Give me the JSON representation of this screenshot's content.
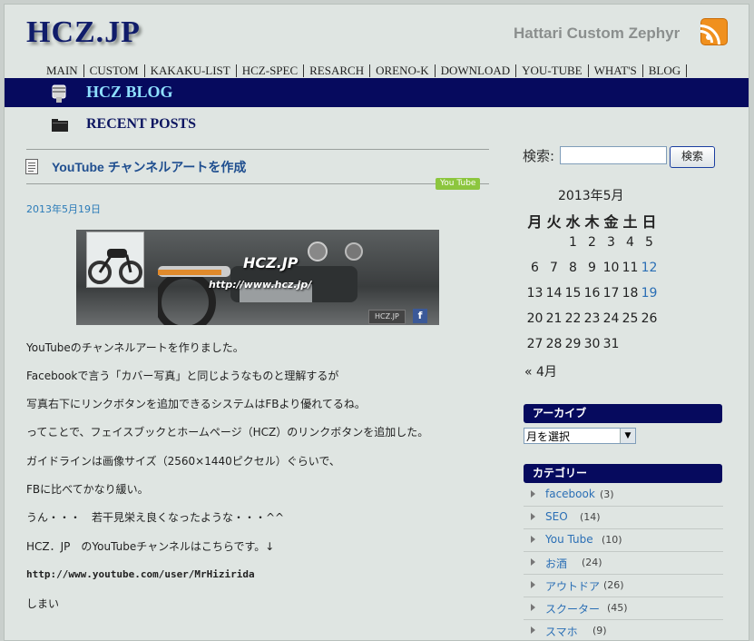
{
  "header": {
    "logo": "HCZ.JP",
    "tagline": "Hattari Custom Zephyr",
    "rss_icon": "rss-feed-icon"
  },
  "nav": [
    "MAIN",
    "CUSTOM",
    "KAKAKU-LIST",
    "HCZ-SPEC",
    "RESARCH",
    "ORENO-K",
    "DOWNLOAD",
    "YOU-TUBE",
    "WHAT'S",
    "BLOG"
  ],
  "blog_title": "HCZ BLOG",
  "section_title": "RECENT POSTS",
  "post": {
    "title": "YouTube チャンネルアートを作成",
    "tag": "You Tube",
    "date": "2013年5月19日",
    "banner": {
      "title": "HCZ.JP",
      "url": "http://www.hcz.jp/",
      "button1": "HCZ.JP",
      "button2": "f"
    },
    "paragraphs": [
      "YouTubeのチャンネルアートを作りました。",
      "Facebookで言う「カバー写真」と同じようなものと理解するが",
      "写真右下にリンクボタンを追加できるシステムはFBより優れてるね。",
      "ってことで、フェイスブックとホームページ（HCZ）のリンクボタンを追加した。",
      "ガイドラインは画像サイズ（2560×1440ピクセル）ぐらいで、",
      "FBに比べてかなり緩い。",
      "うん・・・　若干見栄え良くなったような・・・^^",
      "HCZ．JP　のYouTubeチャンネルはこちらです。↓",
      "http://www.youtube.com/user/MrHizirida",
      "しまい"
    ]
  },
  "sidebar": {
    "search_label": "検索:",
    "search_value": "",
    "search_button": "検索",
    "calendar": {
      "caption": "2013年5月",
      "weekdays": [
        "月",
        "火",
        "水",
        "木",
        "金",
        "土",
        "日"
      ],
      "rows": [
        [
          "",
          "",
          "1",
          "2",
          "3",
          "4",
          "5"
        ],
        [
          "6",
          "7",
          "8",
          "9",
          "10",
          "11",
          "12"
        ],
        [
          "13",
          "14",
          "15",
          "16",
          "17",
          "18",
          "19"
        ],
        [
          "20",
          "21",
          "22",
          "23",
          "24",
          "25",
          "26"
        ],
        [
          "27",
          "28",
          "29",
          "30",
          "31",
          "",
          ""
        ]
      ],
      "linked_days": [
        "12",
        "19"
      ],
      "prev": "« 4月"
    },
    "archive_heading": "アーカイブ",
    "archive_select": "月を選択",
    "category_heading": "カテゴリー",
    "categories": [
      {
        "name": "facebook",
        "count": "(3)"
      },
      {
        "name": "SEO",
        "count": "(14)"
      },
      {
        "name": "You Tube",
        "count": "(10)"
      },
      {
        "name": "お酒",
        "count": "(24)"
      },
      {
        "name": "アウトドア",
        "count": "(26)"
      },
      {
        "name": "スクーター",
        "count": "(45)"
      },
      {
        "name": "スマホ",
        "count": "(9)"
      }
    ]
  },
  "colors": {
    "brand_navy": "#060a5e",
    "link_blue": "#2b6fb5",
    "tag_green": "#8cc63e",
    "rss_orange": "#f0901e"
  }
}
